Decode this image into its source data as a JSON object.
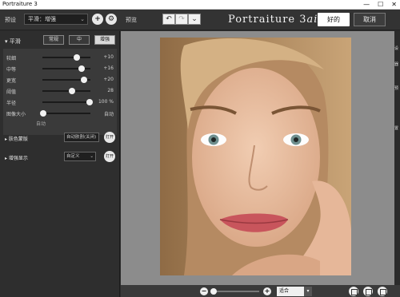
{
  "titlebar": {
    "title": "Portraiture 3",
    "minimize_icon": "minimize-icon",
    "maximize_icon": "maximize-icon",
    "close_icon": "close-icon",
    "minimize_glyph": "—",
    "maximize_glyph": "☐",
    "close_glyph": "✕"
  },
  "topbar": {
    "preset_label": "预设",
    "preset_value": "平滑：增强",
    "preset_chevron": "⌄",
    "add_glyph": "+",
    "settings_glyph": "⚙",
    "preview_label": "预览",
    "undo_glyph": "↶",
    "redo_glyph": "↷",
    "history_glyph": "⌄",
    "brand_main": "Portraiture 3",
    "brand_ai": "ai",
    "ok_label": "好的",
    "cancel_label": "取消"
  },
  "smoothing": {
    "header": "▾ 平滑",
    "tabs": [
      "常规",
      "中",
      "增强"
    ],
    "active_tab": 2,
    "sliders": [
      {
        "label": "较细",
        "value": "+10",
        "level": 0.72
      },
      {
        "label": "中等",
        "value": "+16",
        "level": 0.82
      },
      {
        "label": "更宽",
        "value": "+20",
        "level": 0.86
      },
      {
        "label": "阈值",
        "value": "28",
        "level": 0.62
      },
      {
        "label": "半径",
        "value": "100 %",
        "level": 0.98
      },
      {
        "label": "图像大小",
        "value": "自动",
        "level": 0.02
      }
    ],
    "auto_label": "自动"
  },
  "skin_mask": {
    "label": "▸ 肤色蒙版",
    "select": "自动肤割(关闭)",
    "open_label": "打开"
  },
  "enhancements": {
    "label": "▸ 增强显示",
    "select": "自定义",
    "select_chevron": "⌄",
    "open_label": "打开"
  },
  "right_strip": [
    "设",
    "器",
    "预",
    "置"
  ],
  "bottom": {
    "zoom_minus": "−",
    "zoom_plus": "+",
    "zoom_level": 0.05,
    "zoom_value": "适合",
    "zoom_chevron": "▾"
  },
  "colors": {
    "panel": "#2e2e2e",
    "canvas_bg": "#8c8c8c",
    "accent_white": "#ffffff"
  }
}
